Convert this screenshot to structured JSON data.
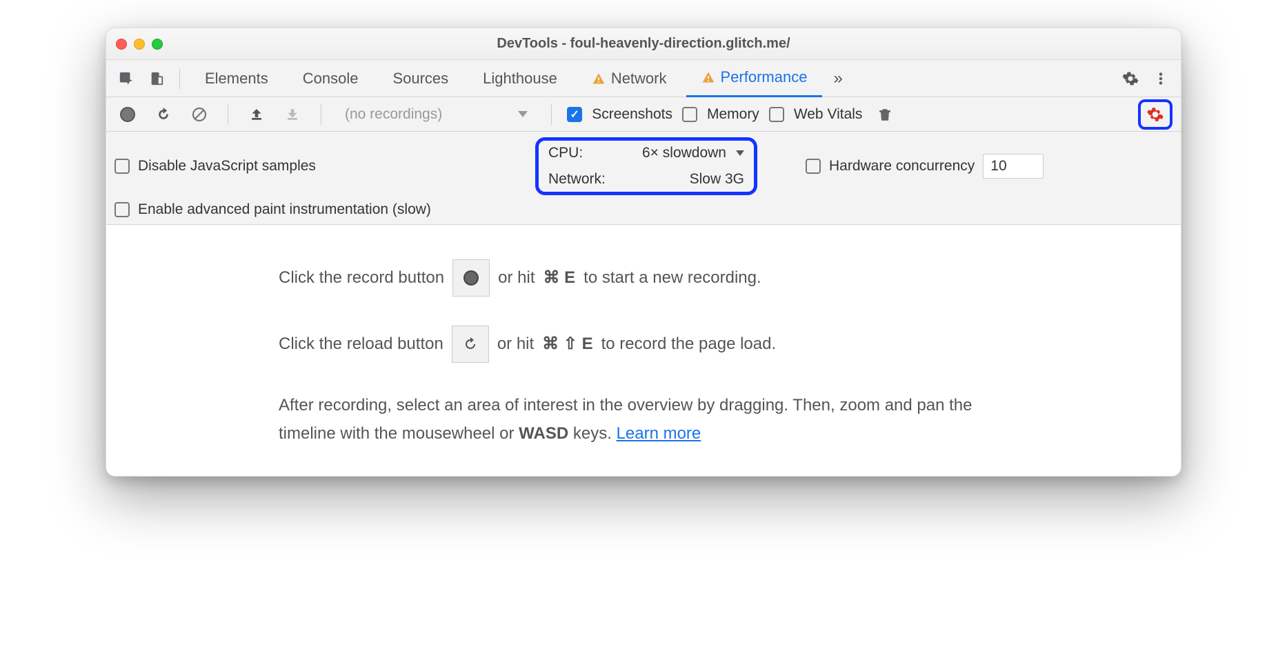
{
  "window": {
    "title": "DevTools - foul-heavenly-direction.glitch.me/"
  },
  "tabs": {
    "elements": "Elements",
    "console": "Console",
    "sources": "Sources",
    "lighthouse": "Lighthouse",
    "network": "Network",
    "performance": "Performance",
    "more": "»"
  },
  "toolbar": {
    "no_recordings": "(no recordings)",
    "screenshots": "Screenshots",
    "memory": "Memory",
    "web_vitals": "Web Vitals"
  },
  "settings": {
    "disable_js": "Disable JavaScript samples",
    "advanced_paint": "Enable advanced paint instrumentation (slow)",
    "cpu_label": "CPU:",
    "cpu_value": "6× slowdown",
    "network_label": "Network:",
    "network_value": "Slow 3G",
    "hw_concurrency": "Hardware concurrency",
    "hw_value": "10"
  },
  "content": {
    "l1a": "Click the record button ",
    "l1b": " or hit ",
    "l1key": "⌘ E",
    "l1c": " to start a new recording.",
    "l2a": "Click the reload button ",
    "l2b": " or hit ",
    "l2key": "⌘ ⇧ E",
    "l2c": " to record the page load.",
    "l3a": "After recording, select an area of interest in the overview by dragging. Then, zoom and pan the timeline with the mousewheel or ",
    "l3k": "WASD",
    "l3b": " keys. ",
    "learn": "Learn more"
  }
}
